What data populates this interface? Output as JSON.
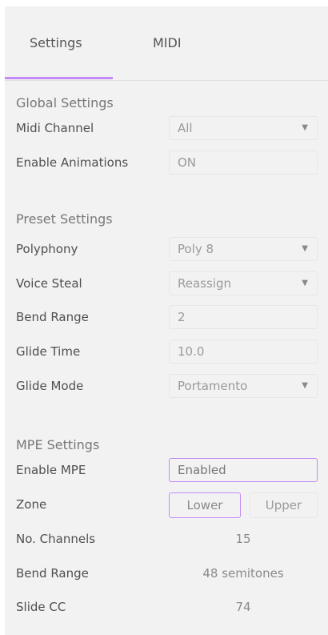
{
  "tabs": [
    {
      "label": "Settings",
      "active": true
    },
    {
      "label": "MIDI",
      "active": false
    }
  ],
  "accent_color": "#c18cf5",
  "global": {
    "title": "Global Settings",
    "midi_channel": {
      "label": "Midi Channel",
      "value": "All"
    },
    "enable_animations": {
      "label": "Enable Animations",
      "value": "ON"
    }
  },
  "preset": {
    "title": "Preset Settings",
    "polyphony": {
      "label": "Polyphony",
      "value": "Poly 8"
    },
    "voice_steal": {
      "label": "Voice Steal",
      "value": "Reassign"
    },
    "bend_range": {
      "label": "Bend Range",
      "value": "2"
    },
    "glide_time": {
      "label": "Glide Time",
      "value": "10.0"
    },
    "glide_mode": {
      "label": "Glide Mode",
      "value": "Portamento"
    }
  },
  "mpe": {
    "title": "MPE Settings",
    "enable_mpe": {
      "label": "Enable MPE",
      "value": "Enabled"
    },
    "zone": {
      "label": "Zone",
      "options": [
        "Lower",
        "Upper"
      ],
      "selected": "Lower"
    },
    "channels": {
      "label": "No. Channels",
      "value": "15"
    },
    "bend_range": {
      "label": "Bend Range",
      "value": "48 semitones"
    },
    "slide_cc": {
      "label": "Slide CC",
      "value": "74"
    }
  },
  "icons": {
    "dropdown": "caret-down-icon"
  }
}
